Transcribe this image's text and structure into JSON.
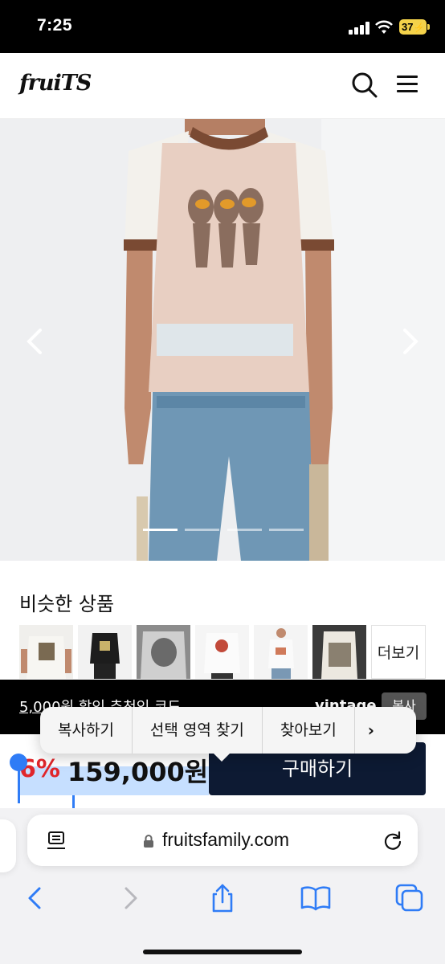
{
  "status_bar": {
    "time": "7:25",
    "battery": "37"
  },
  "header": {
    "logo": "fruiTS"
  },
  "product": {
    "image_count": 4,
    "active_index": 0
  },
  "similar": {
    "title": "비슷한 상품",
    "more_label": "더보기",
    "thumbnails": [
      "thumb-1",
      "thumb-2",
      "thumb-3",
      "thumb-4",
      "thumb-5",
      "thumb-6"
    ]
  },
  "coupon": {
    "text": "5,000원 할인 추천인 코드",
    "code": "vintage",
    "copy_label": "복사"
  },
  "purchase": {
    "discount": "6%",
    "price": "159,000원",
    "buy_label": "구매하기"
  },
  "edit_menu": {
    "items": [
      "복사하기",
      "선택 영역 찾기",
      "찾아보기"
    ],
    "more": "›"
  },
  "browser": {
    "url": "fruitsfamily.com"
  },
  "colors": {
    "accent_red": "#e0262b",
    "buy_button": "#0d1a33",
    "selection": "#2f7cf6"
  }
}
